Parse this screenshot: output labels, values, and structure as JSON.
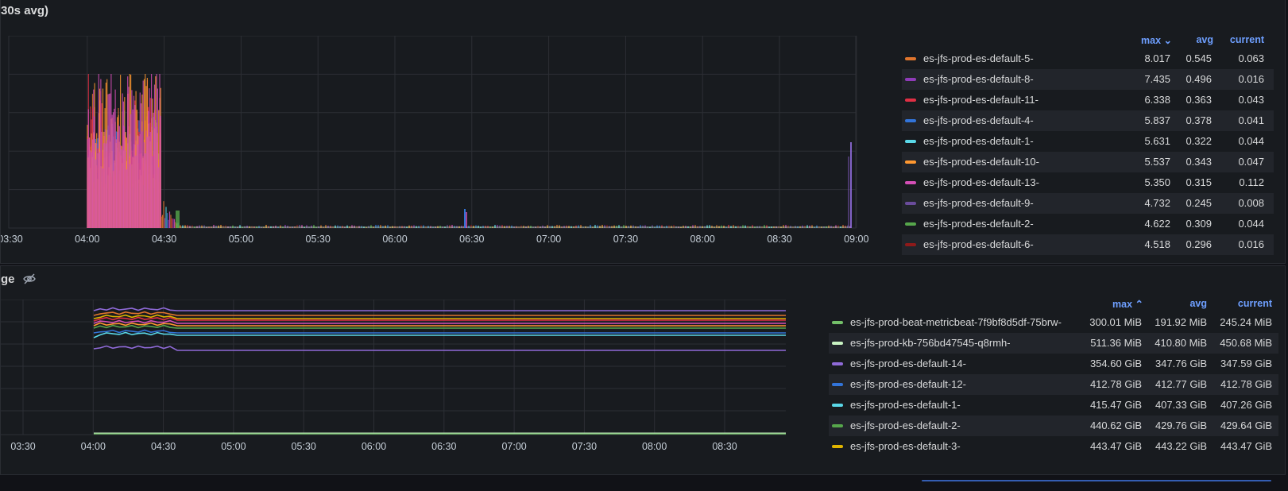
{
  "panel1": {
    "title": "30s avg)",
    "x_ticks": [
      "03:30",
      "04:00",
      "04:30",
      "05:00",
      "05:30",
      "06:00",
      "06:30",
      "07:00",
      "07:30",
      "08:00",
      "08:30",
      "09:00"
    ],
    "legend_headers": {
      "max": "max ⌄",
      "avg": "avg",
      "current": "current"
    },
    "legend": [
      {
        "name": "es-jfs-prod-es-default-5-",
        "color": "#e0752d",
        "max": "8.017",
        "avg": "0.545",
        "current": "0.063"
      },
      {
        "name": "es-jfs-prod-es-default-8-",
        "color": "#8f3bb8",
        "max": "7.435",
        "avg": "0.496",
        "current": "0.016"
      },
      {
        "name": "es-jfs-prod-es-default-11-",
        "color": "#e02f44",
        "max": "6.338",
        "avg": "0.363",
        "current": "0.043"
      },
      {
        "name": "es-jfs-prod-es-default-4-",
        "color": "#3274d9",
        "max": "5.837",
        "avg": "0.378",
        "current": "0.041"
      },
      {
        "name": "es-jfs-prod-es-default-1-",
        "color": "#5ad8e8",
        "max": "5.631",
        "avg": "0.322",
        "current": "0.044"
      },
      {
        "name": "es-jfs-prod-es-default-10-",
        "color": "#ff9830",
        "max": "5.537",
        "avg": "0.343",
        "current": "0.047"
      },
      {
        "name": "es-jfs-prod-es-default-13-",
        "color": "#d44fb6",
        "max": "5.350",
        "avg": "0.315",
        "current": "0.112"
      },
      {
        "name": "es-jfs-prod-es-default-9-",
        "color": "#6a4c9c",
        "max": "4.732",
        "avg": "0.245",
        "current": "0.008"
      },
      {
        "name": "es-jfs-prod-es-default-2-",
        "color": "#56a64b",
        "max": "4.622",
        "avg": "0.309",
        "current": "0.044"
      },
      {
        "name": "es-jfs-prod-es-default-6-",
        "color": "#8e1a1a",
        "max": "4.518",
        "avg": "0.296",
        "current": "0.016"
      }
    ]
  },
  "panel2": {
    "title": "ge",
    "title_icon": "hidden-eye-icon",
    "x_ticks": [
      "03:30",
      "04:00",
      "04:30",
      "05:00",
      "05:30",
      "06:00",
      "06:30",
      "07:00",
      "07:30",
      "08:00",
      "08:30"
    ],
    "legend_headers": {
      "max": "max ⌃",
      "avg": "avg",
      "current": "current"
    },
    "legend": [
      {
        "name": "es-jfs-prod-beat-metricbeat-7f9bf8d5df-75brw-",
        "color": "#73bf69",
        "max": "300.01 MiB",
        "avg": "191.92 MiB",
        "current": "245.24 MiB"
      },
      {
        "name": "es-jfs-prod-kb-756bd47545-q8rmh-",
        "color": "#c8f2c2",
        "max": "511.36 MiB",
        "avg": "410.80 MiB",
        "current": "450.68 MiB"
      },
      {
        "name": "es-jfs-prod-es-default-14-",
        "color": "#8f6ad8",
        "max": "354.60 GiB",
        "avg": "347.76 GiB",
        "current": "347.59 GiB"
      },
      {
        "name": "es-jfs-prod-es-default-12-",
        "color": "#3274d9",
        "max": "412.78 GiB",
        "avg": "412.77 GiB",
        "current": "412.78 GiB"
      },
      {
        "name": "es-jfs-prod-es-default-1-",
        "color": "#5ad8e8",
        "max": "415.47 GiB",
        "avg": "407.33 GiB",
        "current": "407.26 GiB"
      },
      {
        "name": "es-jfs-prod-es-default-2-",
        "color": "#56a64b",
        "max": "440.62 GiB",
        "avg": "429.76 GiB",
        "current": "429.64 GiB"
      },
      {
        "name": "es-jfs-prod-es-default-3-",
        "color": "#e0b400",
        "max": "443.47 GiB",
        "avg": "443.22 GiB",
        "current": "443.47 GiB"
      }
    ]
  }
}
